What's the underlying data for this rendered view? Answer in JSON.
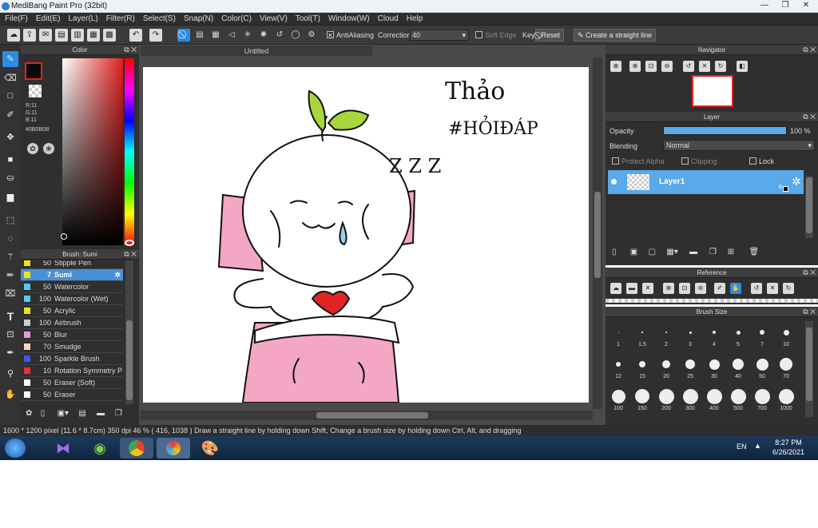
{
  "window": {
    "title": "MediBang Paint Pro (32bit)"
  },
  "menu": [
    "File(F)",
    "Edit(E)",
    "Layer(L)",
    "Filter(R)",
    "Select(S)",
    "Snap(N)",
    "Color(C)",
    "View(V)",
    "Tool(T)",
    "Window(W)",
    "Cloud",
    "Help"
  ],
  "toolbar": {
    "antialias_label": "AntiAliasing",
    "correction_label": "Correction",
    "correction_value": "40",
    "soft_edge_label": "Soft Edge",
    "key_label": "Key",
    "reset_label": "Reset",
    "straight_line_label": "Create a straight line"
  },
  "color_panel": {
    "title": "Color",
    "r": "R:11",
    "g": "G:11",
    "b": "B:11",
    "hex": "#0B0B0B"
  },
  "brush_panel": {
    "title": "Brush: Sumi",
    "brushes": [
      {
        "size": "50",
        "name": "Stipple Pen",
        "color": "#f2e01a"
      },
      {
        "size": "7",
        "name": "Sumi",
        "color": "#f2e01a"
      },
      {
        "size": "50",
        "name": "Watercolor",
        "color": "#5bc8f2"
      },
      {
        "size": "100",
        "name": "Watercolor (Wet)",
        "color": "#5bc8f2"
      },
      {
        "size": "50",
        "name": "Acrylic",
        "color": "#f2e01a"
      },
      {
        "size": "100",
        "name": "Airbrush",
        "color": "#cccccc"
      },
      {
        "size": "50",
        "name": "Blur",
        "color": "#e89ad8"
      },
      {
        "size": "70",
        "name": "Smudge",
        "color": "#f4d8c0"
      },
      {
        "size": "100",
        "name": "Sparkle Brush",
        "color": "#3a5ae8"
      },
      {
        "size": "10",
        "name": "Rotation Symmetry P",
        "color": "#e83030"
      },
      {
        "size": "50",
        "name": "Eraser (Soft)",
        "color": "#ffffff"
      },
      {
        "size": "50",
        "name": "Eraser",
        "color": "#ffffff"
      }
    ]
  },
  "document": {
    "tab": "Untitled"
  },
  "canvas_text": {
    "name": "Thảo",
    "tag": "#HỎIĐÁP",
    "zzz": "Z Z Z"
  },
  "navigator": {
    "title": "Navigator"
  },
  "layer_panel": {
    "title": "Layer",
    "opacity_label": "Opacity",
    "opacity_value": "100 %",
    "opacity_fraction": 1.0,
    "blending_label": "Blending",
    "blending_value": "Normal",
    "protect_alpha": "Protect Alpha",
    "clipping": "Clipping",
    "lock": "Lock",
    "layer_name": "Layer1",
    "layer_badge": "8"
  },
  "reference": {
    "title": "Reference"
  },
  "brush_size": {
    "title": "Brush Size",
    "sizes": [
      "1",
      "1.5",
      "2",
      "3",
      "4",
      "5",
      "7",
      "10",
      "12",
      "15",
      "20",
      "25",
      "30",
      "40",
      "50",
      "70",
      "100",
      "150",
      "200",
      "300",
      "400",
      "500",
      "700",
      "1000"
    ]
  },
  "status": {
    "dims": "1600 * 1200 pixel",
    "cm": "(11.6 * 8.7cm)",
    "dpi": "350 dpi",
    "zoom": "46 %",
    "coords": "( 416, 1038 )",
    "hint": "Draw a straight line by holding down Shift, Change a brush size by holding down Ctrl, Alt, and dragging"
  },
  "taskbar": {
    "lang": "EN",
    "time": "8:27 PM",
    "date": "6/26/2021"
  },
  "colors": {
    "accent": "#2d8be5",
    "panel": "#2f2f2f",
    "selected_row": "#4a90d9",
    "pink": "#f4a7c4",
    "leaf": "#a8d63a",
    "heart": "#e02424"
  }
}
